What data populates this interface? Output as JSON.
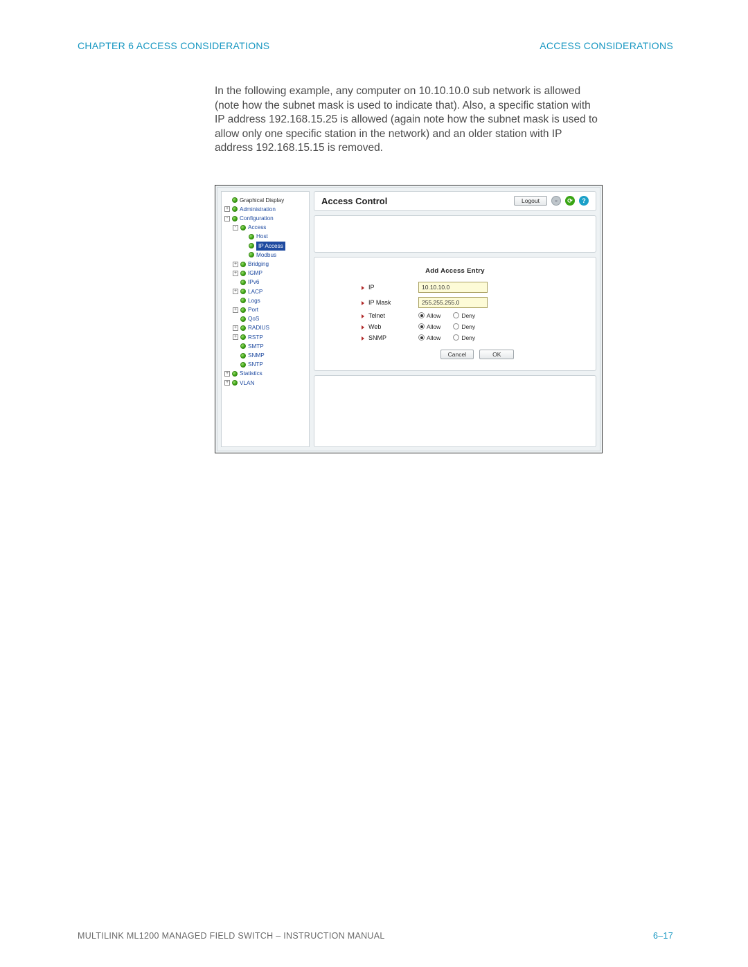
{
  "header": {
    "left": "CHAPTER 6  ACCESS CONSIDERATIONS",
    "right": "ACCESS CONSIDERATIONS"
  },
  "body_paragraph": "In the following example, any computer on 10.10.10.0 sub network is allowed (note how the subnet mask is used to indicate that). Also, a specific station with IP address 192.168.15.25 is allowed (again note how the subnet mask is used to allow only one specific station in the network) and an older station with IP address 192.168.15.15 is removed.",
  "screenshot": {
    "nav": {
      "items": [
        {
          "exp": "",
          "label": "Graphical Display",
          "indent": 0,
          "link": false
        },
        {
          "exp": "+",
          "label": "Administration",
          "indent": 0,
          "link": true
        },
        {
          "exp": "-",
          "label": "Configuration",
          "indent": 0,
          "link": true
        },
        {
          "exp": "-",
          "label": "Access",
          "indent": 1,
          "link": true
        },
        {
          "exp": "",
          "label": "Host",
          "indent": 2,
          "link": true
        },
        {
          "exp": "",
          "label": "IP Access",
          "indent": 2,
          "link": true,
          "selected": true
        },
        {
          "exp": "",
          "label": "Modbus",
          "indent": 2,
          "link": true
        },
        {
          "exp": "+",
          "label": "Bridging",
          "indent": 1,
          "link": true
        },
        {
          "exp": "+",
          "label": "IGMP",
          "indent": 1,
          "link": true
        },
        {
          "exp": "",
          "label": "IPv6",
          "indent": 1,
          "link": true
        },
        {
          "exp": "+",
          "label": "LACP",
          "indent": 1,
          "link": true
        },
        {
          "exp": "",
          "label": "Logs",
          "indent": 1,
          "link": true
        },
        {
          "exp": "+",
          "label": "Port",
          "indent": 1,
          "link": true
        },
        {
          "exp": "",
          "label": "QoS",
          "indent": 1,
          "link": true
        },
        {
          "exp": "+",
          "label": "RADIUS",
          "indent": 1,
          "link": true
        },
        {
          "exp": "+",
          "label": "RSTP",
          "indent": 1,
          "link": true
        },
        {
          "exp": "",
          "label": "SMTP",
          "indent": 1,
          "link": true
        },
        {
          "exp": "",
          "label": "SNMP",
          "indent": 1,
          "link": true
        },
        {
          "exp": "",
          "label": "SNTP",
          "indent": 1,
          "link": true
        },
        {
          "exp": "+",
          "label": "Statistics",
          "indent": 0,
          "link": true
        },
        {
          "exp": "+",
          "label": "VLAN",
          "indent": 0,
          "link": true
        }
      ]
    },
    "title": "Access Control",
    "logout_label": "Logout",
    "form": {
      "title": "Add Access Entry",
      "ip_label": "IP",
      "ip_value": "10.10.10.0",
      "mask_label": "IP Mask",
      "mask_value": "255.255.255.0",
      "rows": [
        {
          "label": "Telnet",
          "value": "Allow"
        },
        {
          "label": "Web",
          "value": "Allow"
        },
        {
          "label": "SNMP",
          "value": "Allow"
        }
      ],
      "opt_allow": "Allow",
      "opt_deny": "Deny",
      "cancel": "Cancel",
      "ok": "OK"
    }
  },
  "footer": {
    "left": "MULTILINK ML1200 MANAGED FIELD SWITCH – INSTRUCTION MANUAL",
    "right": "6–17"
  }
}
